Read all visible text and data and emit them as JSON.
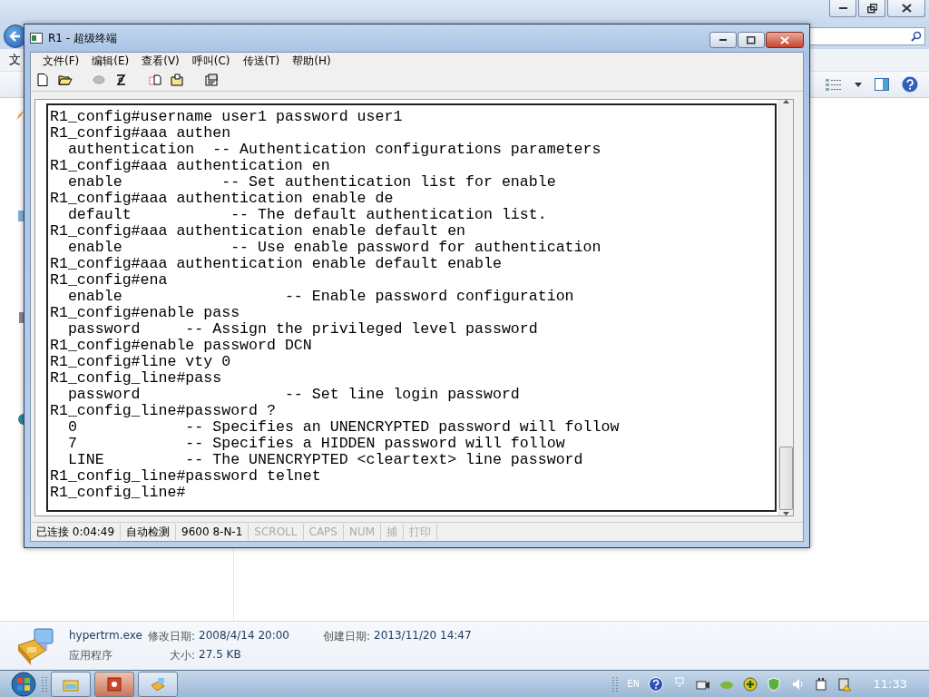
{
  "explorer": {
    "menu_partial": "文",
    "details": {
      "file_name": "hypertrm.exe",
      "file_type": "应用程序",
      "modified_label": "修改日期:",
      "modified": "2008/4/14 20:00",
      "created_label": "创建日期:",
      "created": "2013/11/20 14:47",
      "size_label": "大小:",
      "size": "27.5 KB"
    }
  },
  "terminal_window": {
    "title": "R1 - 超级终端",
    "menu": [
      "文件(F)",
      "编辑(E)",
      "查看(V)",
      "呼叫(C)",
      "传送(T)",
      "帮助(H)"
    ],
    "lines": [
      "R1_config#username user1 password user1",
      "R1_config#aaa authen",
      "  authentication  -- Authentication configurations parameters",
      "R1_config#aaa authentication en",
      "  enable           -- Set authentication list for enable",
      "R1_config#aaa authentication enable de",
      "  default           -- The default authentication list.",
      "R1_config#aaa authentication enable default en",
      "  enable            -- Use enable password for authentication",
      "R1_config#aaa authentication enable default enable",
      "R1_config#ena",
      "  enable                  -- Enable password configuration",
      "R1_config#enable pass",
      "  password     -- Assign the privileged level password",
      "R1_config#enable password DCN",
      "R1_config#line vty 0",
      "R1_config_line#pass",
      "  password                -- Set line login password",
      "R1_config_line#password ?",
      "  0            -- Specifies an UNENCRYPTED password will follow",
      "  7            -- Specifies a HIDDEN password will follow",
      "  LINE         -- The UNENCRYPTED <cleartext> line password",
      "R1_config_line#password telnet",
      "R1_config_line#"
    ],
    "status_bar": [
      {
        "text": "已连接 0:04:49",
        "disabled": false
      },
      {
        "text": "自动检测",
        "disabled": false
      },
      {
        "text": "9600 8-N-1",
        "disabled": false
      },
      {
        "text": "SCROLL",
        "disabled": true
      },
      {
        "text": "CAPS",
        "disabled": true
      },
      {
        "text": "NUM",
        "disabled": true
      },
      {
        "text": "捕",
        "disabled": true
      },
      {
        "text": "打印",
        "disabled": true
      }
    ]
  },
  "taskbar": {
    "language": "EN",
    "clock": "11:33"
  }
}
